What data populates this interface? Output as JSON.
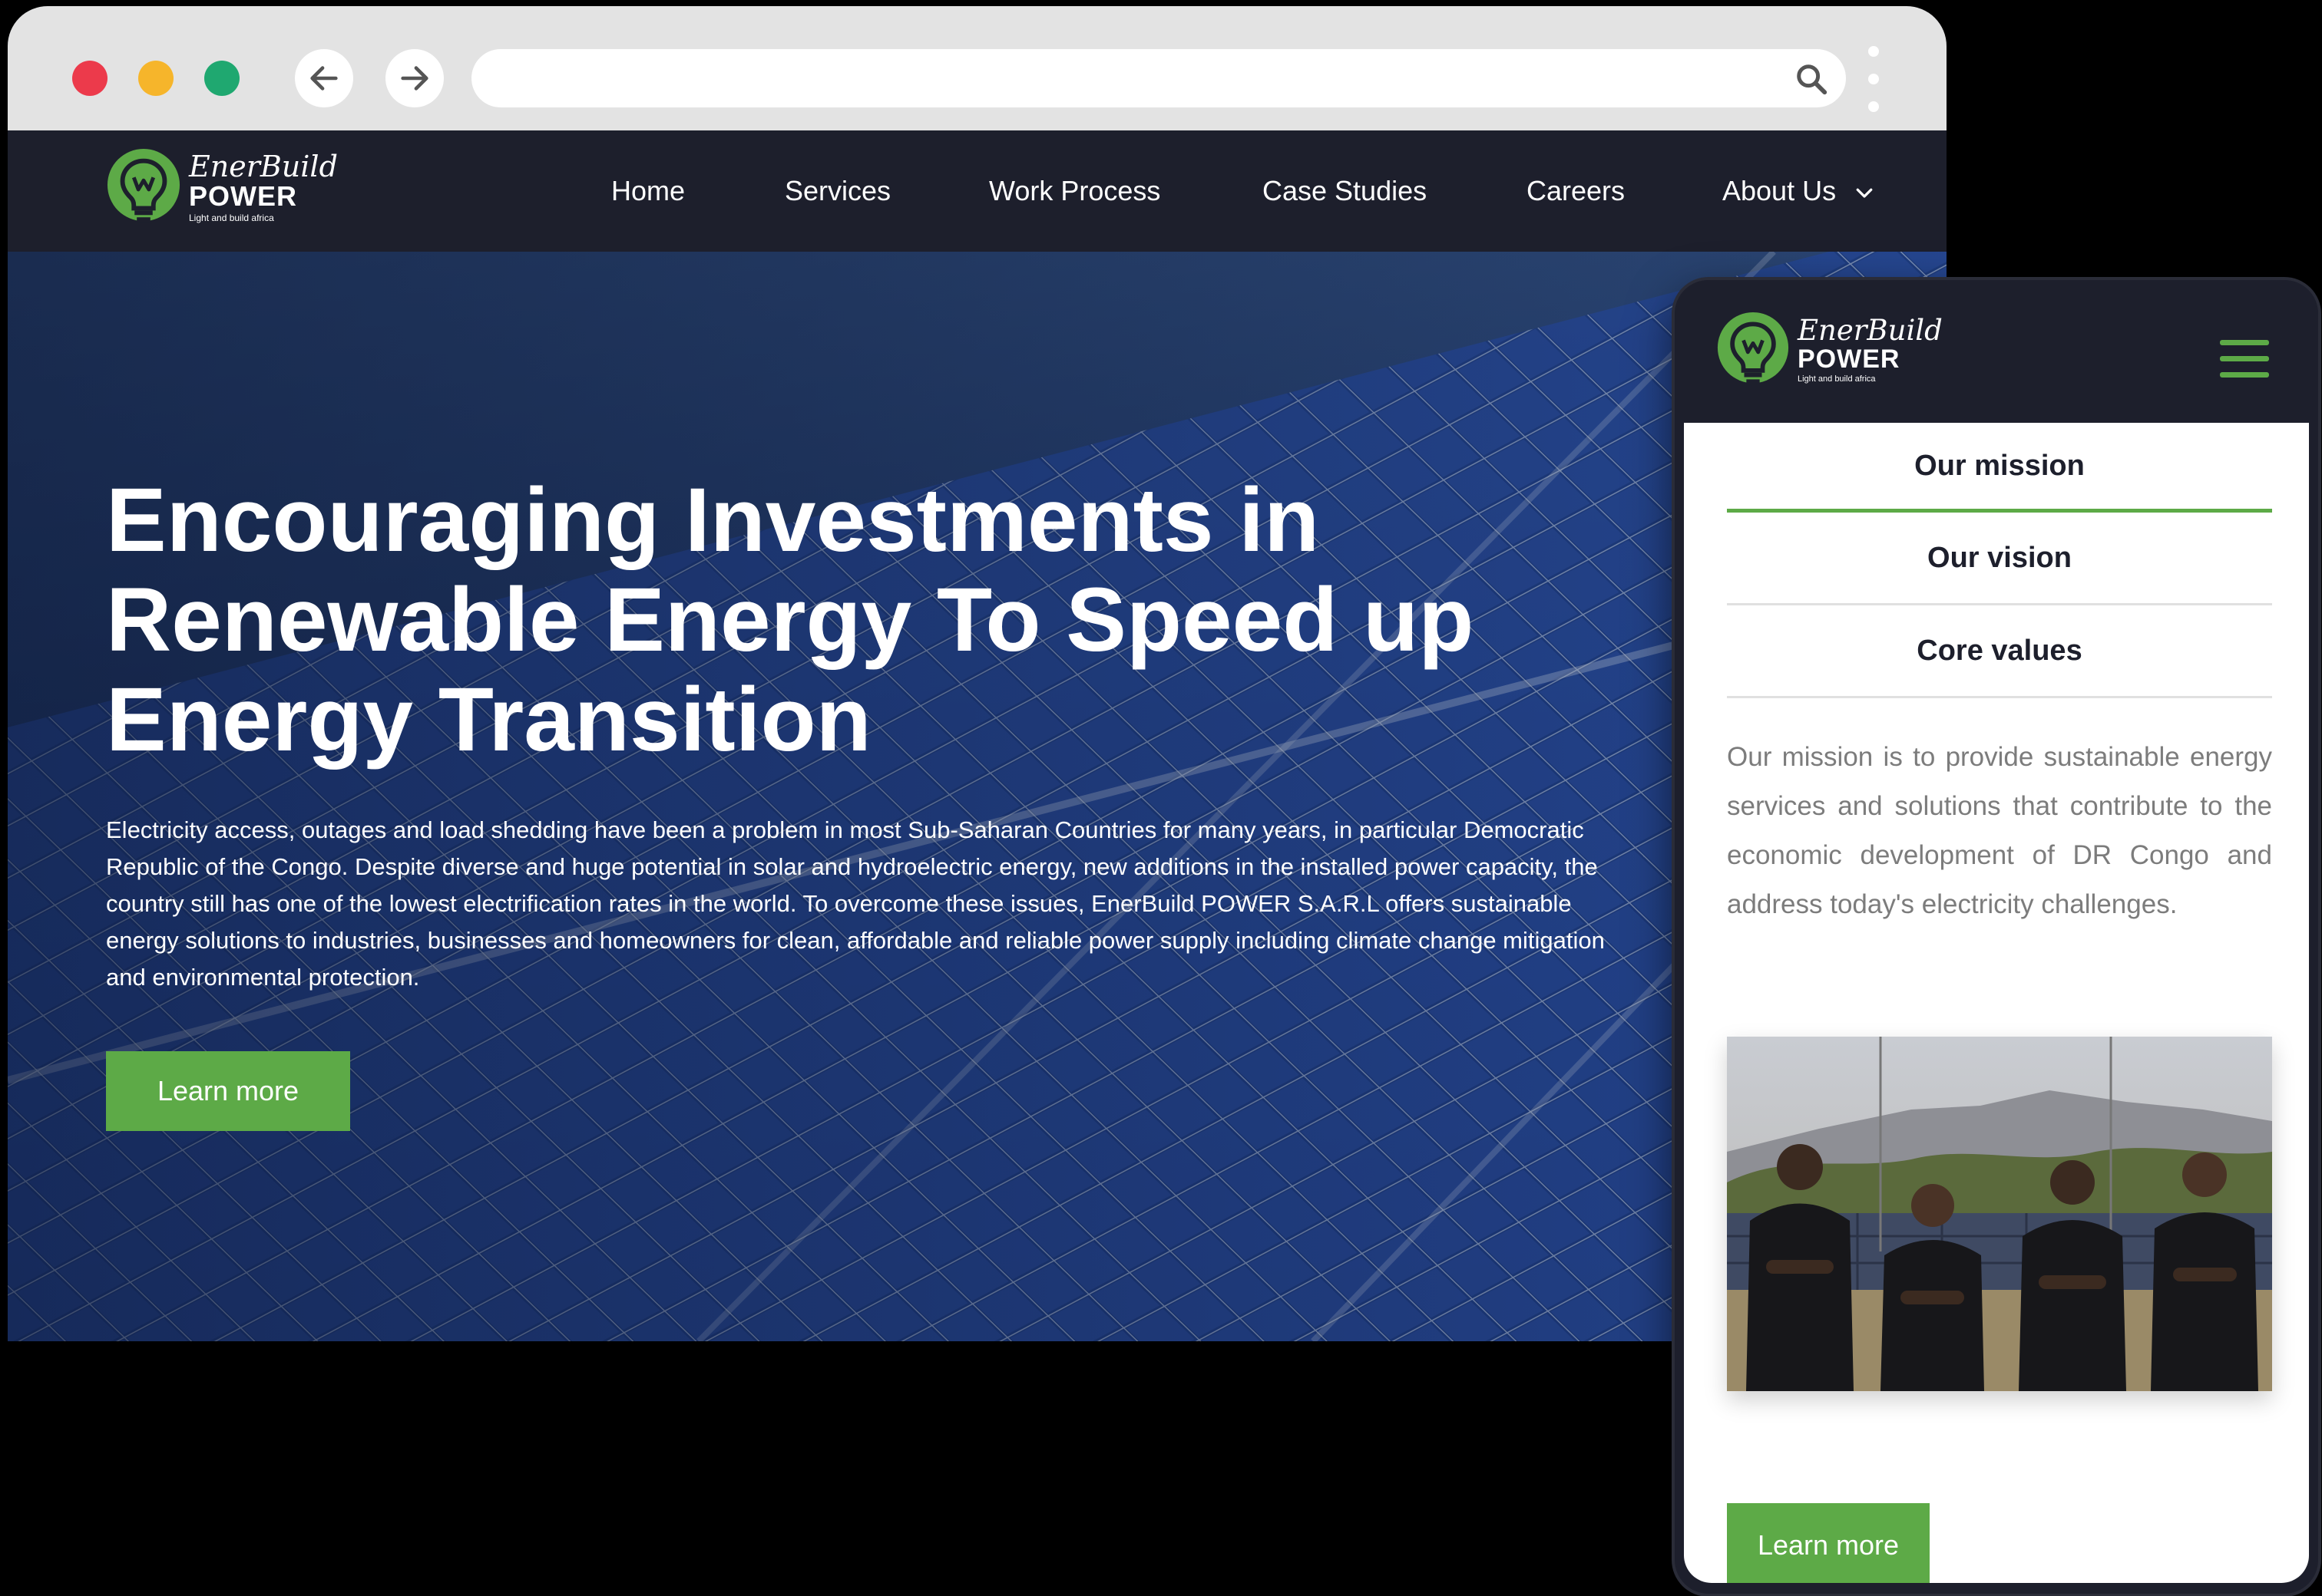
{
  "browser": {
    "window_controls": [
      "close",
      "minimize",
      "maximize"
    ],
    "back_icon": "arrow-left-icon",
    "forward_icon": "arrow-right-icon",
    "url_value": "",
    "search_icon": "search-icon",
    "menu_icon": "vertical-dots-icon"
  },
  "brand": {
    "name_top": "EnerBuild",
    "name_main": "POWER",
    "tagline": "Light and build africa",
    "accent_color": "#5daa47",
    "dark_color": "#1d1f2c"
  },
  "nav": {
    "items": [
      {
        "label": "Home"
      },
      {
        "label": "Services"
      },
      {
        "label": "Work Process"
      },
      {
        "label": "Case Studies"
      },
      {
        "label": "Careers"
      },
      {
        "label": "About Us",
        "icon": "chevron-down-icon"
      }
    ]
  },
  "hero": {
    "title_lines": [
      "Encouraging Investments in",
      "Renewable Energy To Speed up",
      "Energy Transition"
    ],
    "text": "Electricity access, outages and load shedding have been a problem in most Sub-Saharan Countries for many years, in particular Democratic Republic of the Congo. Despite diverse and huge potential in solar and hydroelectric energy, new additions in the installed power capacity, the country still has one of the lowest electrification rates in the world. To overcome these issues, EnerBuild POWER S.A.R.L offers sustainable energy solutions to industries, businesses and homeowners for clean, affordable and reliable power supply including climate change mitigation and environmental protection.",
    "button": "Learn more"
  },
  "mobile": {
    "menu_icon": "hamburger-icon",
    "tabs": [
      {
        "label": "Our mission",
        "active": true
      },
      {
        "label": "Our vision",
        "active": false
      },
      {
        "label": "Core values",
        "active": false
      }
    ],
    "mission_text": "Our mission is to provide sustainable energy services and solutions that contribute to the economic development of DR Congo and address today's electricity challenges.",
    "button": "Learn more"
  }
}
